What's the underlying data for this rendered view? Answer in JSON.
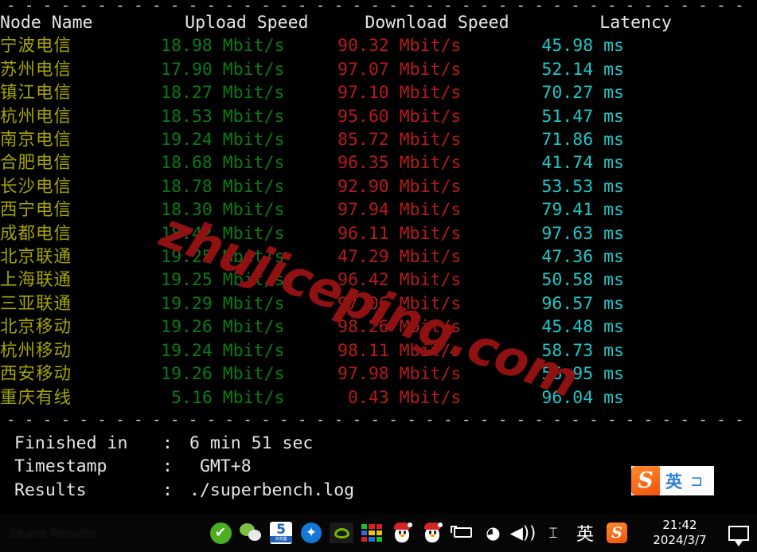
{
  "terminal": {
    "divider": "- - - - - - - - - - - - - - - - - - - - - - - - - - - - - - - - - - - - - - - - - - - - - - - - - - - - - -",
    "headers": {
      "node": "Node Name",
      "upload": "Upload Speed",
      "download": "Download Speed",
      "latency": "Latency"
    },
    "unit_speed": " Mbit/s",
    "unit_latency": " ms",
    "rows": [
      {
        "node": "宁波电信",
        "upload": "18.98",
        "download": "90.32",
        "latency": "45.98"
      },
      {
        "node": "苏州电信",
        "upload": "17.90",
        "download": "97.07",
        "latency": "52.14"
      },
      {
        "node": "镇江电信",
        "upload": "18.27",
        "download": "97.10",
        "latency": "70.27"
      },
      {
        "node": "杭州电信",
        "upload": "18.53",
        "download": "95.60",
        "latency": "51.47"
      },
      {
        "node": "南京电信",
        "upload": "19.24",
        "download": "85.72",
        "latency": "71.86"
      },
      {
        "node": "合肥电信",
        "upload": "18.68",
        "download": "96.35",
        "latency": "41.74"
      },
      {
        "node": "长沙电信",
        "upload": "18.78",
        "download": "92.90",
        "latency": "53.53"
      },
      {
        "node": "西宁电信",
        "upload": "18.30",
        "download": "97.94",
        "latency": "79.41"
      },
      {
        "node": "成都电信",
        "upload": "18.42",
        "download": "96.11",
        "latency": "97.63"
      },
      {
        "node": "北京联通",
        "upload": "19.25",
        "download": "47.29",
        "latency": "47.36"
      },
      {
        "node": "上海联通",
        "upload": "19.25",
        "download": "96.42",
        "latency": "50.58"
      },
      {
        "node": "三亚联通",
        "upload": "19.29",
        "download": "97.06",
        "latency": "96.57"
      },
      {
        "node": "北京移动",
        "upload": "19.26",
        "download": "98.26",
        "latency": "45.48"
      },
      {
        "node": "杭州移动",
        "upload": "19.24",
        "download": "98.11",
        "latency": "58.73"
      },
      {
        "node": "西安移动",
        "upload": "19.26",
        "download": "97.98",
        "latency": "56.95"
      },
      {
        "node": "重庆有线",
        "upload": "5.16",
        "download": "0.43",
        "latency": "96.04"
      }
    ],
    "summary": [
      {
        "label": "Finished in",
        "sep": ":",
        "value": "6 min 51 sec"
      },
      {
        "label": "Timestamp",
        "sep": ":",
        "value": " GMT+8"
      },
      {
        "label": "Results",
        "sep": ":",
        "value": "./superbench.log"
      }
    ],
    "colors": {
      "node": "#a5a500",
      "upload": "#0a7a14",
      "download": "#b51a1a",
      "latency": "#1fc6c6",
      "header": "#e6e6e6",
      "background": "#000000"
    }
  },
  "watermark": {
    "text": "zhujiceping.com",
    "color": "#8f1111"
  },
  "ime_bar": {
    "logo": "S",
    "mode_label": "英",
    "keyboard_label": "⊐"
  },
  "taskbar": {
    "faded_text": "Share  Results",
    "tray": [
      {
        "name": "security-check-icon",
        "label": "✔"
      },
      {
        "name": "wechat-icon",
        "label": ""
      },
      {
        "name": "sogou-browser-5-icon",
        "label": "5",
        "sub": "浏览器"
      },
      {
        "name": "bluetooth-icon",
        "label": "✦"
      },
      {
        "name": "nvidia-icon",
        "label": ""
      },
      {
        "name": "color-grid-icon",
        "label": ""
      },
      {
        "name": "qq-penguin-icon-1",
        "label": ""
      },
      {
        "name": "qq-penguin-icon-2",
        "label": ""
      },
      {
        "name": "battery-charging-icon",
        "label": ""
      },
      {
        "name": "wifi-icon",
        "label": "◗"
      },
      {
        "name": "volume-icon",
        "label": "🔊"
      },
      {
        "name": "keyboard-icon",
        "label": "⌨"
      },
      {
        "name": "ime-lang-icon",
        "label": "英"
      },
      {
        "name": "sogou-ime-icon",
        "label": "S"
      }
    ],
    "clock": {
      "time": "21:42",
      "date": "2024/3/7"
    }
  }
}
